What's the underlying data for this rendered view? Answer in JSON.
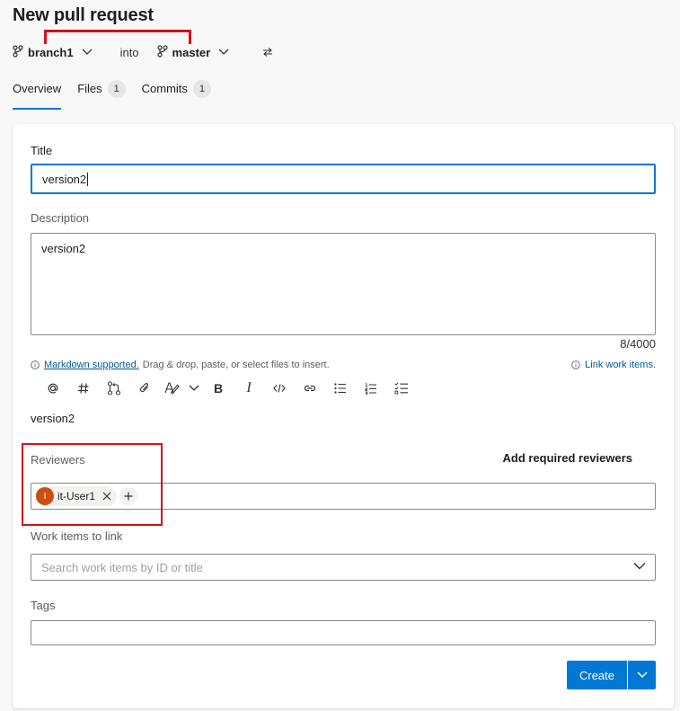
{
  "header": {
    "title": "New pull request"
  },
  "branches": {
    "source": "branch1",
    "into": "into",
    "target": "master"
  },
  "tabs": [
    {
      "label": "Overview"
    },
    {
      "label": "Files",
      "count": "1"
    },
    {
      "label": "Commits",
      "count": "1"
    }
  ],
  "form": {
    "title_label": "Title",
    "title_value": "version2",
    "description_label": "Description",
    "description_value": "version2",
    "char_count": "8/4000",
    "markdown_link": "Markdown supported.",
    "markdown_hint": "Drag & drop, paste, or select files to insert.",
    "link_work_items": "Link work items.",
    "preview_text": "version2",
    "reviewers_label": "Reviewers",
    "add_required_reviewers": "Add required reviewers",
    "reviewer": {
      "initial": "I",
      "name": "it-User1"
    },
    "work_items_label": "Work items to link",
    "work_items_placeholder": "Search work items by ID or title",
    "tags_label": "Tags",
    "tags_value": "",
    "create_label": "Create"
  },
  "toolbar_icons": [
    "mention-icon",
    "hashtag-icon",
    "pull-request-icon",
    "attach-icon",
    "highlight-icon",
    "chevron-down-icon",
    "bold-icon",
    "italic-icon",
    "code-icon",
    "link-icon",
    "bullet-list-icon",
    "numbered-list-icon",
    "task-list-icon"
  ],
  "colors": {
    "accent": "#0078d4",
    "annotation": "#d0121b",
    "avatar": "#ca5010"
  }
}
